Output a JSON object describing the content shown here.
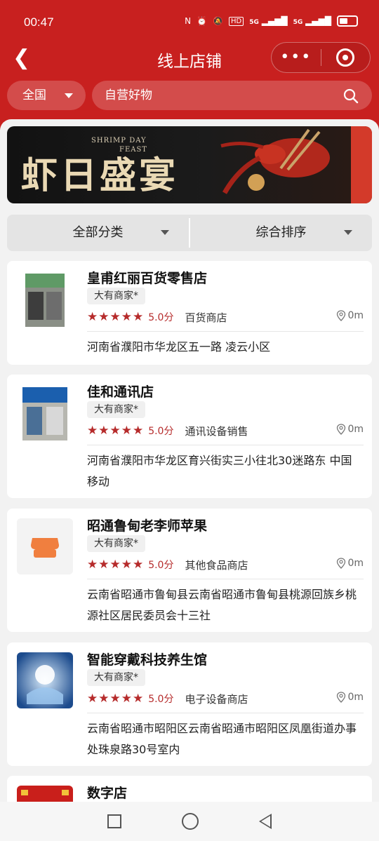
{
  "status_bar": {
    "time": "00:47",
    "icons": [
      "nfc-icon",
      "alarm-icon",
      "mute-icon",
      "hd-icon",
      "signal-5g-icon",
      "signal-5g-icon",
      "battery-icon"
    ],
    "hd_label": "HD",
    "net1": "5G",
    "net2": "5G"
  },
  "header": {
    "title": "线上店铺",
    "back_icon": "chevron-left-icon",
    "more_icon": "more-dots-icon",
    "close_icon": "target-icon"
  },
  "search_bar": {
    "region": "全国",
    "placeholder": "自营好物",
    "search_icon": "search-icon"
  },
  "banner": {
    "title": "虾日盛宴",
    "subtitle_line1": "SHRIMP DAY",
    "subtitle_line2": "FEAST"
  },
  "filters": {
    "category": "全部分类",
    "sort": "综合排序"
  },
  "stores": [
    {
      "name": "皇甫红丽百货零售店",
      "badge": "大有商家*",
      "stars": "★★★★★",
      "score": "5.0分",
      "category": "百货商店",
      "distance": "0m",
      "address": "河南省濮阳市华龙区五一路 凌云小区"
    },
    {
      "name": "佳和通讯店",
      "badge": "大有商家*",
      "stars": "★★★★★",
      "score": "5.0分",
      "category": "通讯设备销售",
      "distance": "0m",
      "address": "河南省濮阳市华龙区育兴街实三小往北30迷路东 中国移动"
    },
    {
      "name": "昭通鲁甸老李师苹果",
      "badge": "大有商家*",
      "stars": "★★★★★",
      "score": "5.0分",
      "category": "其他食品商店",
      "distance": "0m",
      "address": "云南省昭通市鲁甸县云南省昭通市鲁甸县桃源回族乡桃源社区居民委员会十三社"
    },
    {
      "name": "智能穿戴科技养生馆",
      "badge": "大有商家*",
      "stars": "★★★★★",
      "score": "5.0分",
      "category": "电子设备商店",
      "distance": "0m",
      "address": "云南省昭通市昭阳区云南省昭通市昭阳区凤凰街道办事处珠泉路30号室内"
    },
    {
      "name": "数字店"
    }
  ],
  "colors": {
    "brand_red": "#c8201f",
    "star_red": "#b62b2b"
  }
}
